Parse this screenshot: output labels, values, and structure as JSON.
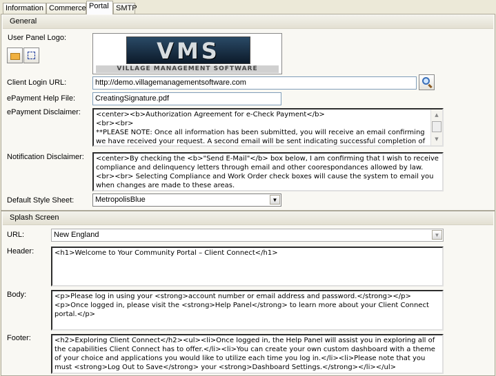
{
  "tabs": [
    {
      "label": "Information"
    },
    {
      "label": "Commerce"
    },
    {
      "label": "Portal",
      "selected": true
    },
    {
      "label": "SMTP"
    }
  ],
  "general": {
    "title": "General",
    "logo_label": "User Panel Logo:",
    "logo": {
      "main": "VMS",
      "sub": "VILLAGE MANAGEMENT SOFTWARE"
    },
    "client_login_url_label": "Client Login URL:",
    "client_login_url": "http://demo.villagemanagementsoftware.com",
    "help_file_label": "ePayment Help File:",
    "help_file": "CreatingSignature.pdf",
    "disclaimer_label": "ePayment Disclaimer:",
    "disclaimer": "<center><b>Authorization Agreement for e-Check Payment</b>\n<br><br>\n**PLEASE NOTE: Once all information has been submitted, you will receive an email confirming we have received your request. A second email will be sent indicating successful completion of your",
    "notification_label": "Notification Disclaimer:",
    "notification": "<center>By checking the <b>\"Send E-Mail\"</b> box below, I am confirming that I wish to receive compliance and delinquency letters through email and other coorespondances allowed by law. <br><br> Selecting Compliance and Work Order check boxes will cause the system to email you when changes are made to these areas.",
    "style_sheet_label": "Default Style Sheet:",
    "style_sheet": "MetropolisBlue"
  },
  "splash": {
    "title": "Splash Screen",
    "url_label": "URL:",
    "url": "New England",
    "header_label": "Header:",
    "header": "<h1>Welcome to Your Community Portal – Client Connect</h1>",
    "body_label": "Body:",
    "body": "<p>Please log in using your <strong>account number or email address and password.</strong></p><p>Once logged in, please visit the <strong>Help Panel</strong> to learn more about your Client Connect portal.</p>",
    "footer_label": "Footer:",
    "footer": "<h2>Exploring Client Connect</h2><ul><li>Once logged in, the Help Panel will assist you in exploring all of the capabilities Client Connect has to offer.</li><li>You can create your own custom dashboard with a theme of your choice and applications you would like to utilize each time you log in.</li><li>Please note that you must <strong>Log Out to Save</strong> your <strong>Dashboard Settings.</strong></li></ul>"
  }
}
